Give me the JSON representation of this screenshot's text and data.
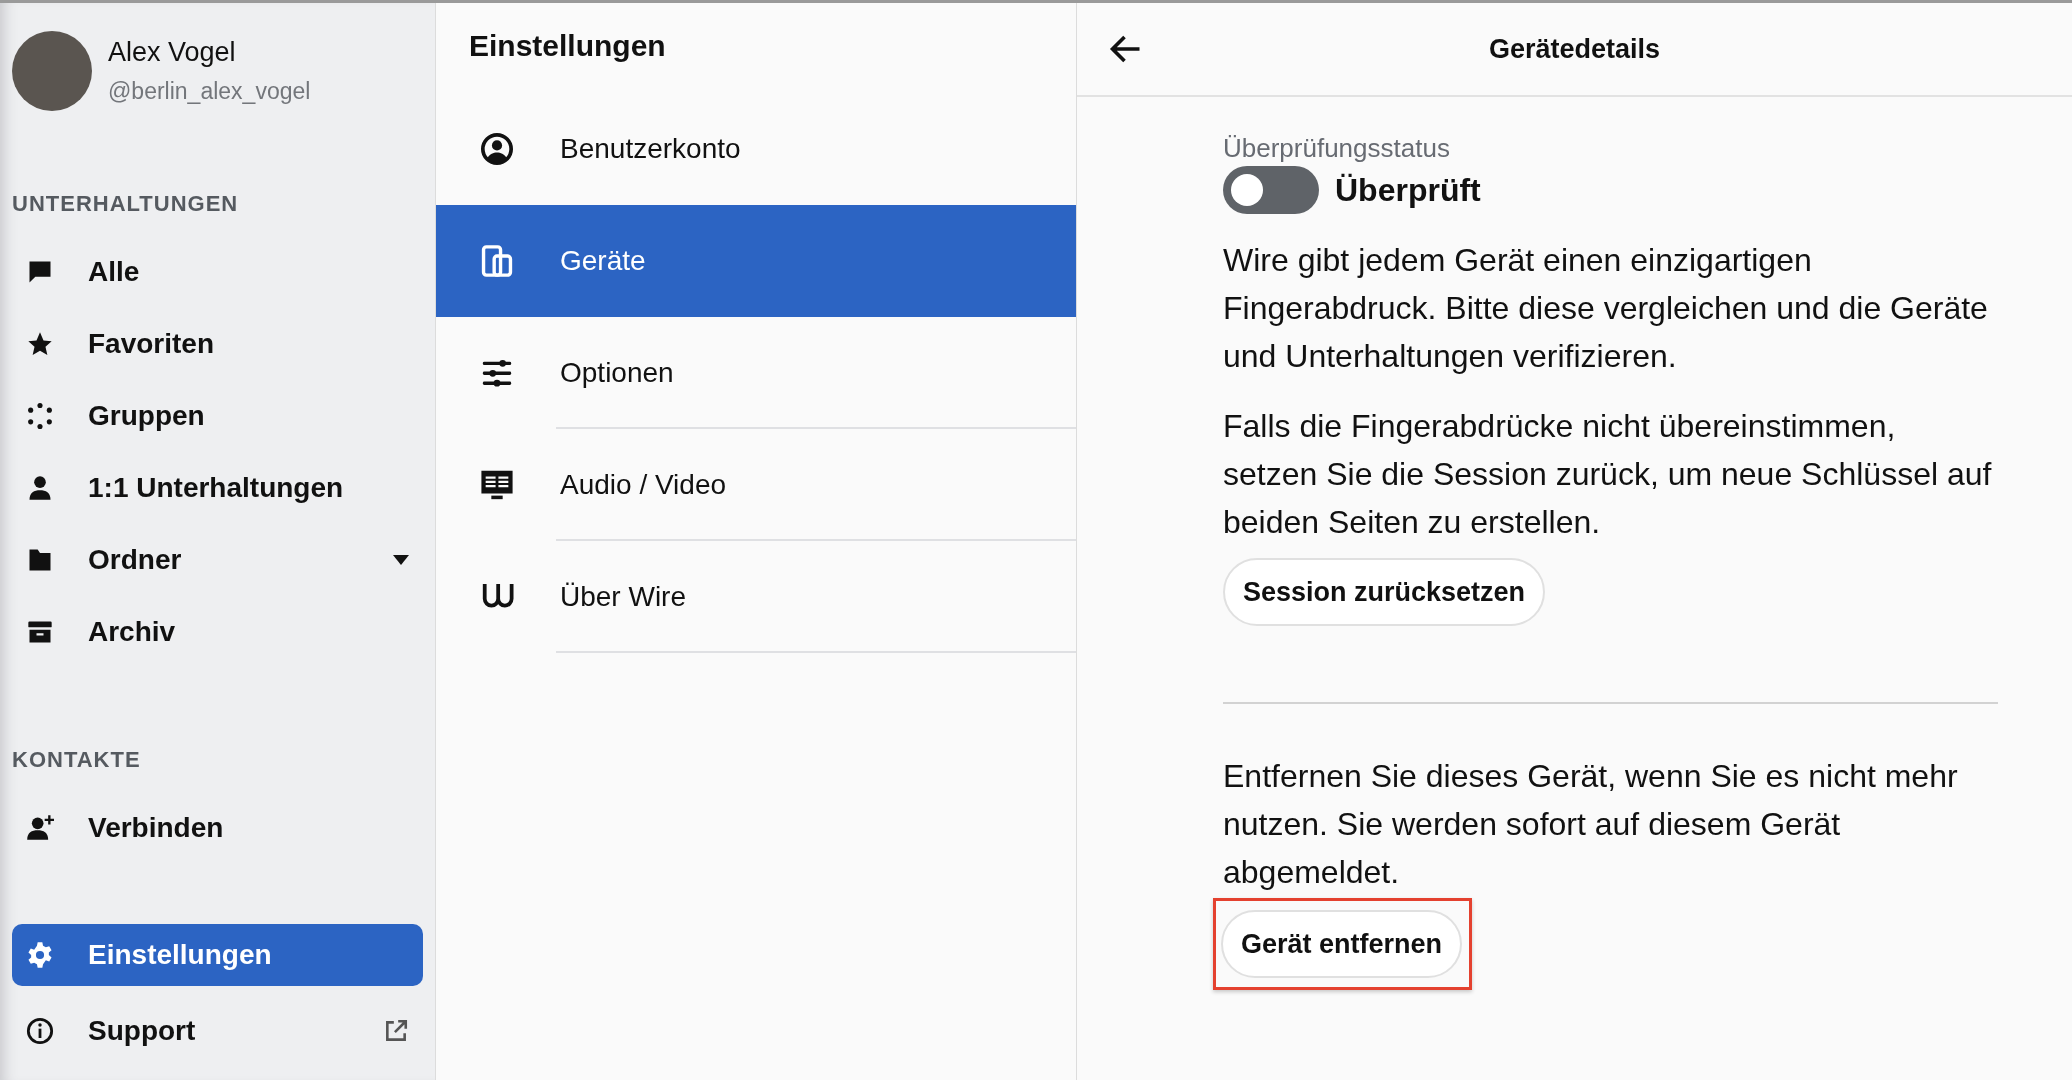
{
  "profile": {
    "name": "Alex Vogel",
    "handle": "@berlin_alex_vogel"
  },
  "sidebar": {
    "sections": [
      {
        "heading": "UNTERHALTUNGEN",
        "items": [
          {
            "kind": "chat",
            "label": "Alle",
            "selected": false,
            "dropdown": false,
            "external": false
          },
          {
            "kind": "star",
            "label": "Favoriten",
            "selected": false,
            "dropdown": false,
            "external": false
          },
          {
            "kind": "groups",
            "label": "Gruppen",
            "selected": false,
            "dropdown": false,
            "external": false
          },
          {
            "kind": "person",
            "label": "1:1 Unterhaltungen",
            "selected": false,
            "dropdown": false,
            "external": false
          },
          {
            "kind": "folder",
            "label": "Ordner",
            "selected": false,
            "dropdown": true,
            "external": false
          },
          {
            "kind": "archive",
            "label": "Archiv",
            "selected": false,
            "dropdown": false,
            "external": false
          }
        ]
      },
      {
        "heading": "KONTAKTE",
        "items": [
          {
            "kind": "person-add",
            "label": "Verbinden",
            "selected": false,
            "dropdown": false,
            "external": false
          }
        ]
      }
    ],
    "footer_items": [
      {
        "kind": "gear",
        "label": "Einstellungen",
        "selected": true,
        "dropdown": false,
        "external": false
      },
      {
        "kind": "info",
        "label": "Support",
        "selected": false,
        "dropdown": false,
        "external": true
      }
    ]
  },
  "settings": {
    "title": "Einstellungen",
    "items": [
      {
        "kind": "account",
        "label": "Benutzerkonto",
        "selected": false
      },
      {
        "kind": "devices",
        "label": "Geräte",
        "selected": true
      },
      {
        "kind": "sliders",
        "label": "Optionen",
        "selected": false
      },
      {
        "kind": "av",
        "label": "Audio / Video",
        "selected": false
      },
      {
        "kind": "wire",
        "label": "Über Wire",
        "selected": false
      }
    ]
  },
  "details": {
    "title": "Gerätedetails",
    "status_label": "Überprüfungsstatus",
    "toggle": {
      "label": "Überprüft",
      "on": false
    },
    "paragraph_1": "Wire gibt jedem Gerät einen einzigartigen Fingerabdruck. Bitte diese vergleichen und die Geräte und Unterhaltungen verifizieren.",
    "paragraph_2": "Falls die Fingerabdrücke nicht übereinstimmen, setzen Sie die Session zurück, um neue Schlüssel auf beiden Seiten zu erstellen.",
    "reset_button": {
      "label": "Session zurücksetzen",
      "highlighted": false
    },
    "paragraph_3": "Entfernen Sie dieses Gerät, wenn Sie es nicht mehr nutzen. Sie werden sofort auf diesem Gerät abgemeldet.",
    "remove_button": {
      "label": "Gerät entfernen",
      "highlighted": true
    }
  }
}
